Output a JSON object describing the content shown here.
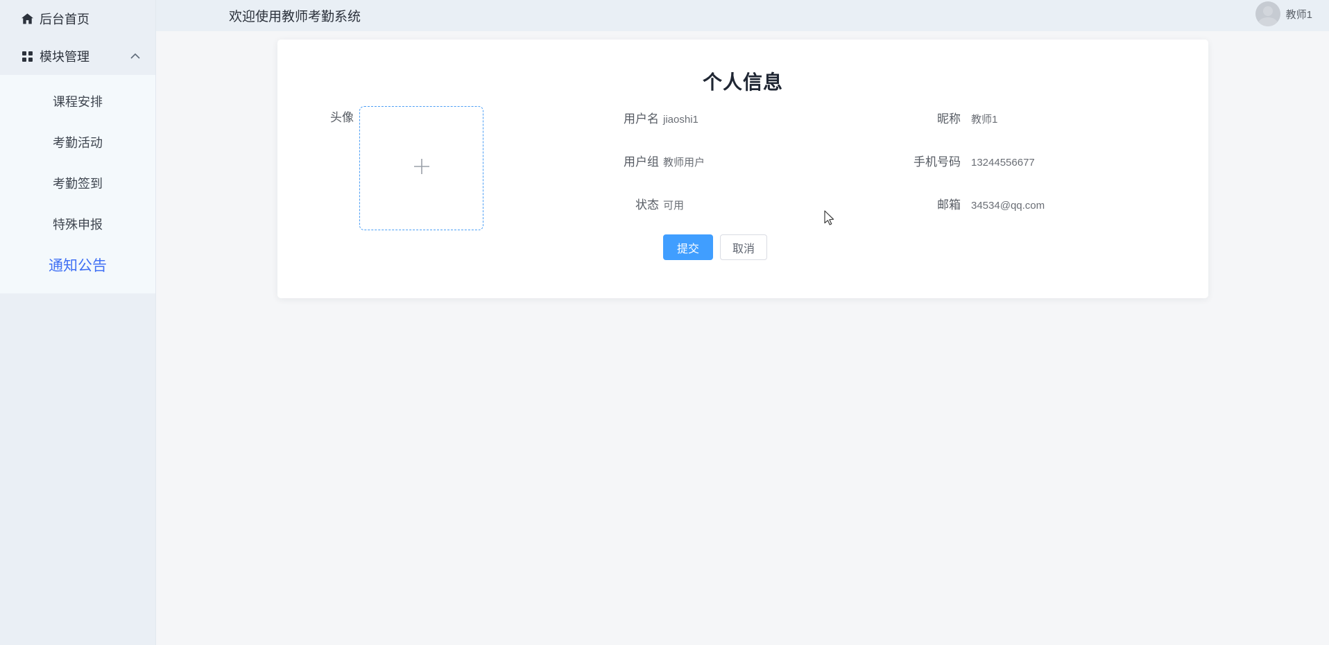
{
  "app": {
    "welcome": "欢迎使用教师考勤系统",
    "user_name": "教师1"
  },
  "sidebar": {
    "items": [
      {
        "label": "后台首页",
        "icon": "home-icon"
      },
      {
        "label": "模块管理",
        "icon": "grid-icon",
        "expanded": true
      }
    ],
    "submenu": [
      {
        "label": "课程安排"
      },
      {
        "label": "考勤活动"
      },
      {
        "label": "考勤签到"
      },
      {
        "label": "特殊申报"
      },
      {
        "label": "通知公告"
      }
    ],
    "active_item": "通知公告"
  },
  "profile": {
    "title": "个人信息",
    "avatar_label": "头像",
    "fields": {
      "username": {
        "label": "用户名",
        "value": "jiaoshi1"
      },
      "nickname": {
        "label": "昵称",
        "value": "教师1"
      },
      "group": {
        "label": "用户组",
        "value": "教师用户"
      },
      "phone": {
        "label": "手机号码",
        "value": "13244556677"
      },
      "status": {
        "label": "状态",
        "value": "可用"
      },
      "email": {
        "label": "邮箱",
        "value": "34534@qq.com"
      }
    },
    "buttons": {
      "submit": "提交",
      "cancel": "取消"
    }
  },
  "colors": {
    "primary_button": "#409eff",
    "active_menu": "#4070f4",
    "upload_border": "#4b9ef5",
    "header_bg": "#e9eff5",
    "sidebar_bg": "#eaeff5",
    "submenu_bg": "#f4f9fc",
    "content_bg": "#f5f6f8"
  }
}
